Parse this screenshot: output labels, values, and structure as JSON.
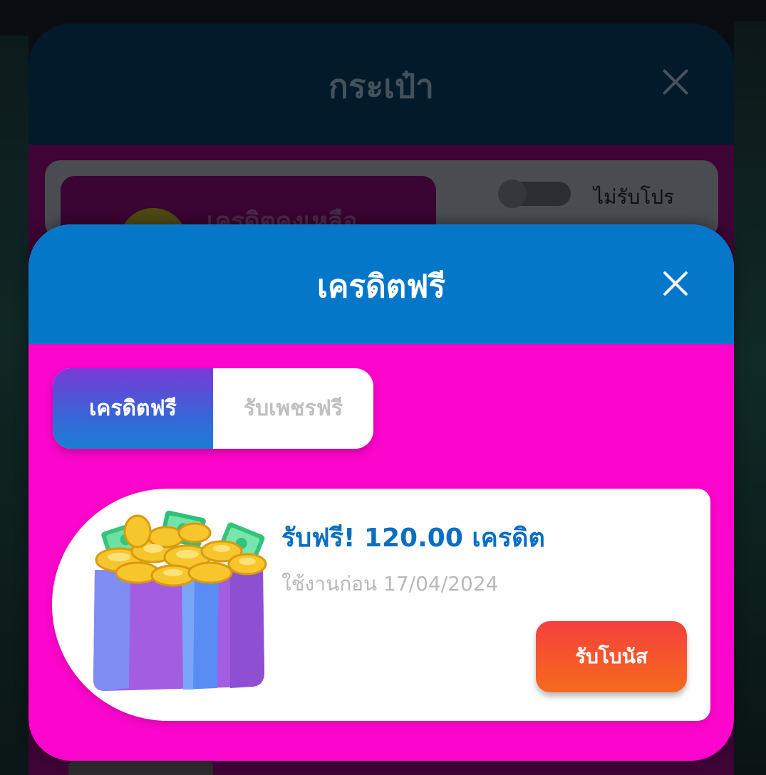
{
  "wallet": {
    "title": "กระเป๋า",
    "credit_label": "เครดิตคงเหลือ",
    "promo_toggle_label": "ไม่รับโปร"
  },
  "free_credit": {
    "title": "เครดิตฟรี",
    "tabs": [
      {
        "label": "เครดิตฟรี",
        "active": true
      },
      {
        "label": "รับเพชรฟรี",
        "active": false
      }
    ],
    "offer": {
      "title": "รับฟรี! 120.00 เครดิต",
      "subtitle": "ใช้งานก่อน 17/04/2024",
      "button_label": "รับโบนัส",
      "image": "gift-box-with-coins-and-cash"
    }
  },
  "colors": {
    "header_blue": "#0477c9",
    "modal_magenta": "#fc05cc",
    "offer_title_blue": "#0a6fc2",
    "button_orange": "#f6531f"
  }
}
